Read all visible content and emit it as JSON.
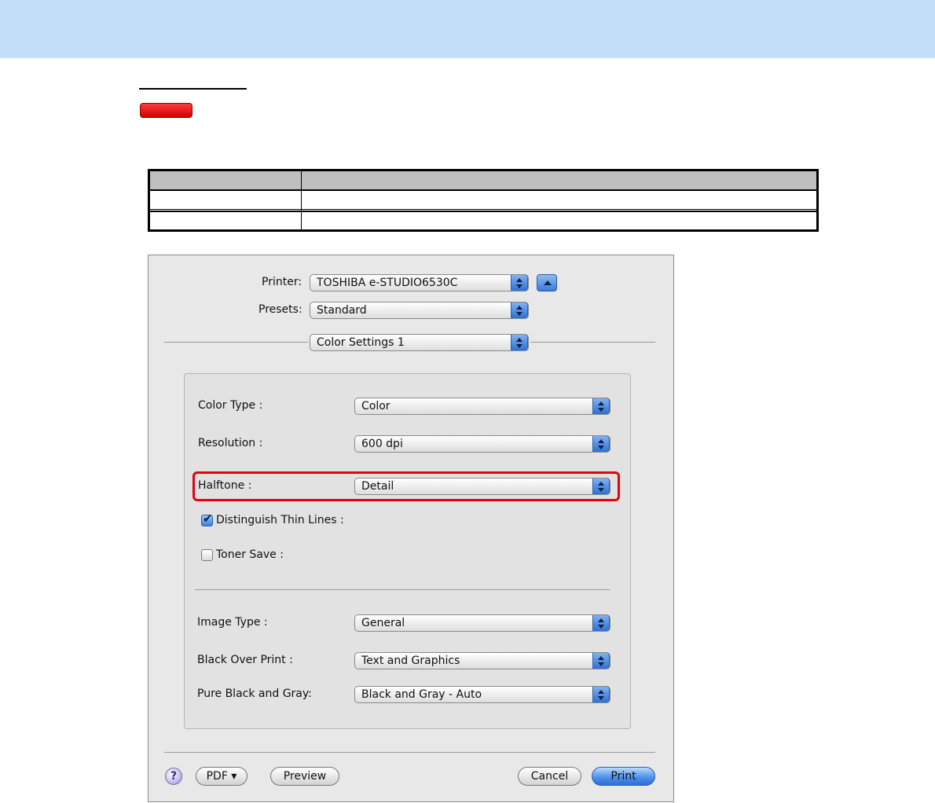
{
  "dialog": {
    "printer_label": "Printer:",
    "printer_value": "TOSHIBA e-STUDIO6530C",
    "presets_label": "Presets:",
    "presets_value": "Standard",
    "panel_value": "Color Settings 1",
    "settings": {
      "color_type_label": "Color Type :",
      "color_type_value": "Color",
      "resolution_label": "Resolution :",
      "resolution_value": "600 dpi",
      "halftone_label": "Halftone :",
      "halftone_value": "Detail",
      "thin_lines_label": "Distinguish Thin Lines :",
      "thin_lines_checked": true,
      "toner_save_label": "Toner Save :",
      "toner_save_checked": false,
      "image_type_label": "Image Type :",
      "image_type_value": "General",
      "black_over_print_label": "Black Over Print :",
      "black_over_print_value": "Text and Graphics",
      "pure_black_gray_label": "Pure Black and Gray:",
      "pure_black_gray_value": "Black and Gray - Auto"
    },
    "footer": {
      "help_label": "?",
      "pdf_label": "PDF ▾",
      "preview_label": "Preview",
      "cancel_label": "Cancel",
      "print_label": "Print"
    }
  },
  "colors": {
    "header_bar": "#c3dffa",
    "highlight": "#e60012",
    "accent_blue": "#3a7ad9"
  }
}
